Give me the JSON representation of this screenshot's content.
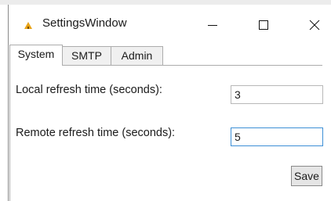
{
  "window": {
    "title": "SettingsWindow",
    "controls": {
      "minimize": "minimize-icon",
      "maximize": "maximize-icon",
      "close": "close-icon"
    }
  },
  "tabs": [
    {
      "label": "System",
      "selected": true
    },
    {
      "label": "SMTP",
      "selected": false
    },
    {
      "label": "Admin",
      "selected": false
    }
  ],
  "system": {
    "local_refresh_label": "Local refresh time (seconds):",
    "local_refresh_value": "3",
    "remote_refresh_label": "Remote refresh time (seconds):",
    "remote_refresh_value": "5"
  },
  "actions": {
    "save_label": "Save"
  },
  "colors": {
    "focus_border": "#3d8fd6",
    "app_icon": "#e8a317"
  }
}
